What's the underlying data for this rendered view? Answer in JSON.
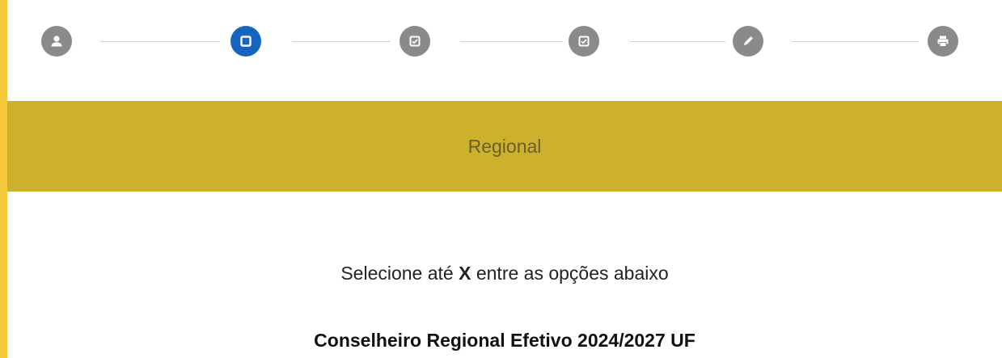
{
  "stepper": {
    "active_index": 1,
    "steps": [
      {
        "icon": "person-icon"
      },
      {
        "icon": "square-icon"
      },
      {
        "icon": "checkbox-icon"
      },
      {
        "icon": "checkbox-icon"
      },
      {
        "icon": "pencil-icon"
      },
      {
        "icon": "printer-icon"
      }
    ],
    "colors": {
      "inactive": "#8a8a8a",
      "active": "#1565c0"
    }
  },
  "header": {
    "title": "Regional",
    "background": "#cdb02c"
  },
  "instruction": {
    "prefix": "Selecione até",
    "highlight": "X",
    "suffix": "entre as opções abaixo"
  },
  "section": {
    "title": "Conselheiro Regional Efetivo 2024/2027 UF"
  },
  "page": {
    "border_color": "#f5c93b"
  }
}
